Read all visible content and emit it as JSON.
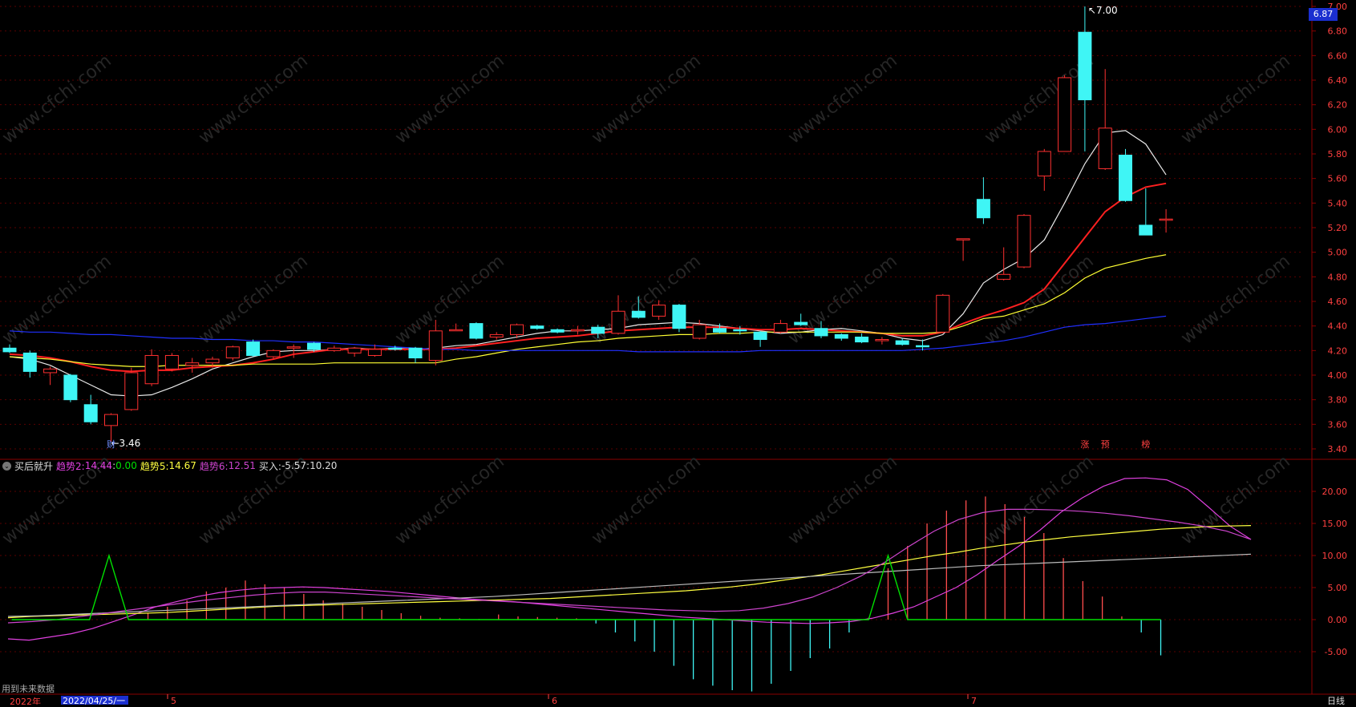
{
  "chart_data": [
    {
      "type": "candlestick",
      "title": "",
      "price_axis": {
        "ticks": [
          "7.00",
          "6.80",
          "6.60",
          "6.40",
          "6.20",
          "6.00",
          "5.80",
          "5.60",
          "5.40",
          "5.20",
          "5.00",
          "4.80",
          "4.60",
          "4.40",
          "4.20",
          "4.00",
          "3.80",
          "3.60",
          "3.40"
        ],
        "ylim": [
          3.34,
          7.02
        ]
      },
      "current_price": "6.87",
      "high_label": "7.00",
      "low_label": "3.46",
      "markers": [
        {
          "text": "财",
          "bar": 5,
          "color": "#6f8cff"
        },
        {
          "text": "涨",
          "bar": 53,
          "color": "#ff4040"
        },
        {
          "text": "预",
          "bar": 54,
          "color": "#ff4040"
        },
        {
          "text": "榜",
          "bar": 56,
          "color": "#ff4040"
        }
      ],
      "candles": [
        [
          4.22,
          4.25,
          4.18,
          4.19
        ],
        [
          4.18,
          4.2,
          3.98,
          4.03
        ],
        [
          4.02,
          4.07,
          3.92,
          4.05
        ],
        [
          4.0,
          4.01,
          3.78,
          3.8
        ],
        [
          3.76,
          3.84,
          3.6,
          3.62
        ],
        [
          3.59,
          3.69,
          3.46,
          3.68
        ],
        [
          3.72,
          4.06,
          3.71,
          4.02
        ],
        [
          3.93,
          4.21,
          3.91,
          4.16
        ],
        [
          4.05,
          4.18,
          4.03,
          4.16
        ],
        [
          4.08,
          4.14,
          4.02,
          4.1
        ],
        [
          4.1,
          4.15,
          4.06,
          4.13
        ],
        [
          4.14,
          4.24,
          4.12,
          4.23
        ],
        [
          4.27,
          4.29,
          4.15,
          4.16
        ],
        [
          4.15,
          4.21,
          4.13,
          4.2
        ],
        [
          4.22,
          4.25,
          4.14,
          4.23
        ],
        [
          4.26,
          4.27,
          4.19,
          4.21
        ],
        [
          4.2,
          4.24,
          4.19,
          4.22
        ],
        [
          4.18,
          4.23,
          4.15,
          4.22
        ],
        [
          4.16,
          4.25,
          4.15,
          4.21
        ],
        [
          4.22,
          4.24,
          4.2,
          4.21
        ],
        [
          4.22,
          4.23,
          4.1,
          4.14
        ],
        [
          4.12,
          4.45,
          4.08,
          4.36
        ],
        [
          4.37,
          4.42,
          4.36,
          4.37
        ],
        [
          4.42,
          4.43,
          4.29,
          4.3
        ],
        [
          4.31,
          4.35,
          4.29,
          4.33
        ],
        [
          4.33,
          4.42,
          4.3,
          4.41
        ],
        [
          4.4,
          4.41,
          4.37,
          4.38
        ],
        [
          4.37,
          4.38,
          4.34,
          4.35
        ],
        [
          4.36,
          4.4,
          4.33,
          4.37
        ],
        [
          4.39,
          4.41,
          4.3,
          4.34
        ],
        [
          4.34,
          4.65,
          4.33,
          4.52
        ],
        [
          4.52,
          4.64,
          4.46,
          4.47
        ],
        [
          4.48,
          4.61,
          4.45,
          4.57
        ],
        [
          4.57,
          4.58,
          4.35,
          4.38
        ],
        [
          4.3,
          4.45,
          4.29,
          4.41
        ],
        [
          4.38,
          4.42,
          4.34,
          4.35
        ],
        [
          4.37,
          4.4,
          4.33,
          4.36
        ],
        [
          4.35,
          4.36,
          4.23,
          4.29
        ],
        [
          4.35,
          4.45,
          4.34,
          4.42
        ],
        [
          4.43,
          4.5,
          4.4,
          4.41
        ],
        [
          4.38,
          4.44,
          4.3,
          4.32
        ],
        [
          4.33,
          4.34,
          4.28,
          4.3
        ],
        [
          4.31,
          4.34,
          4.26,
          4.27
        ],
        [
          4.28,
          4.31,
          4.25,
          4.29
        ],
        [
          4.28,
          4.3,
          4.24,
          4.25
        ],
        [
          4.24,
          4.29,
          4.2,
          4.23
        ],
        [
          4.35,
          4.66,
          4.34,
          4.65
        ],
        [
          5.1,
          5.11,
          4.93,
          5.11
        ],
        [
          5.43,
          5.61,
          5.23,
          5.28
        ],
        [
          4.78,
          5.04,
          4.77,
          4.82
        ],
        [
          4.88,
          5.31,
          4.87,
          5.3
        ],
        [
          5.62,
          5.84,
          5.5,
          5.82
        ],
        [
          5.82,
          6.44,
          5.82,
          6.42
        ],
        [
          6.79,
          7.0,
          5.82,
          6.24
        ],
        [
          5.68,
          6.49,
          5.67,
          6.01
        ],
        [
          5.79,
          5.84,
          5.41,
          5.42
        ],
        [
          5.22,
          5.52,
          5.15,
          5.14
        ],
        [
          5.27,
          5.35,
          5.16,
          5.27
        ]
      ],
      "ma_series": [
        {
          "color": "#e8e8e8",
          "values": [
            4.15,
            4.13,
            4.08,
            4.0,
            3.92,
            3.84,
            3.83,
            3.84,
            3.9,
            3.97,
            4.05,
            4.1,
            4.15,
            4.19,
            4.2,
            4.2,
            4.21,
            4.22,
            4.21,
            4.22,
            4.21,
            4.22,
            4.24,
            4.25,
            4.28,
            4.31,
            4.34,
            4.36,
            4.36,
            4.37,
            4.38,
            4.41,
            4.42,
            4.43,
            4.42,
            4.4,
            4.38,
            4.36,
            4.34,
            4.35,
            4.37,
            4.38,
            4.36,
            4.34,
            4.3,
            4.28,
            4.33,
            4.5,
            4.75,
            4.86,
            4.95,
            5.1,
            5.4,
            5.72,
            5.97,
            5.99,
            5.88,
            5.63
          ]
        },
        {
          "color": "#ff2020",
          "values": [
            4.17,
            4.16,
            4.14,
            4.11,
            4.07,
            4.04,
            4.03,
            4.04,
            4.04,
            4.06,
            4.07,
            4.08,
            4.1,
            4.13,
            4.17,
            4.19,
            4.21,
            4.21,
            4.21,
            4.21,
            4.21,
            4.21,
            4.22,
            4.24,
            4.26,
            4.28,
            4.3,
            4.31,
            4.32,
            4.34,
            4.36,
            4.37,
            4.38,
            4.39,
            4.39,
            4.39,
            4.38,
            4.37,
            4.37,
            4.38,
            4.37,
            4.36,
            4.35,
            4.34,
            4.32,
            4.32,
            4.35,
            4.42,
            4.48,
            4.53,
            4.59,
            4.7,
            4.91,
            5.12,
            5.33,
            5.45,
            5.53,
            5.56
          ]
        },
        {
          "color": "#ffff33",
          "values": [
            4.15,
            4.14,
            4.13,
            4.11,
            4.09,
            4.08,
            4.07,
            4.07,
            4.08,
            4.08,
            4.08,
            4.08,
            4.09,
            4.09,
            4.09,
            4.09,
            4.1,
            4.1,
            4.1,
            4.1,
            4.1,
            4.1,
            4.13,
            4.15,
            4.18,
            4.21,
            4.23,
            4.25,
            4.27,
            4.28,
            4.3,
            4.31,
            4.32,
            4.33,
            4.33,
            4.34,
            4.34,
            4.35,
            4.35,
            4.35,
            4.35,
            4.35,
            4.35,
            4.34,
            4.34,
            4.34,
            4.35,
            4.4,
            4.46,
            4.48,
            4.53,
            4.58,
            4.67,
            4.79,
            4.87,
            4.91,
            4.95,
            4.98
          ]
        },
        {
          "color": "#2030ff",
          "values": [
            4.36,
            4.35,
            4.35,
            4.34,
            4.33,
            4.33,
            4.32,
            4.31,
            4.3,
            4.3,
            4.29,
            4.29,
            4.28,
            4.28,
            4.27,
            4.27,
            4.26,
            4.25,
            4.24,
            4.23,
            4.22,
            4.21,
            4.21,
            4.2,
            4.2,
            4.2,
            4.2,
            4.2,
            4.2,
            4.2,
            4.2,
            4.19,
            4.19,
            4.19,
            4.19,
            4.19,
            4.19,
            4.2,
            4.2,
            4.2,
            4.2,
            4.2,
            4.2,
            4.2,
            4.2,
            4.21,
            4.22,
            4.24,
            4.26,
            4.28,
            4.31,
            4.35,
            4.39,
            4.41,
            4.42,
            4.44,
            4.46,
            4.48
          ]
        }
      ]
    },
    {
      "type": "line",
      "title": "买后就升",
      "yaxis_ticks": [
        "20.00",
        "15.00",
        "10.00",
        "5.00",
        "0.00",
        "-5.00"
      ],
      "ylim": [
        -11.2,
        25.5
      ],
      "series": [
        {
          "name": "趋势2",
          "color": "#e040e0",
          "values": [
            -3.0,
            -3.2,
            -2.7,
            -2.2,
            -1.4,
            -0.3,
            0.8,
            2.0,
            2.8,
            3.6,
            4.2,
            4.6,
            4.9,
            5.0,
            5.1,
            5.0,
            4.8,
            4.6,
            4.4,
            4.1,
            3.8,
            3.5,
            3.2,
            3.0,
            2.8,
            2.5,
            2.2,
            1.9,
            1.6,
            1.3,
            1.0,
            0.7,
            0.4,
            0.2,
            0.0,
            -0.2,
            -0.4,
            -0.5,
            -0.6,
            -0.5,
            -0.3,
            0.2,
            1.0,
            2.0,
            3.5,
            5.0,
            7.0,
            9.3,
            11.5,
            14.0,
            16.8,
            19.0,
            20.8,
            22.0,
            22.1,
            21.8,
            20.3,
            17.5,
            14.6,
            12.5
          ]
        },
        {
          "name": "",
          "color": "#00e000",
          "values": [
            0,
            0,
            0,
            0,
            0,
            10,
            0,
            0,
            0,
            0,
            0,
            0,
            0,
            0,
            0,
            0,
            0,
            0,
            0,
            0,
            0,
            0,
            0,
            0,
            0,
            0,
            0,
            0,
            0,
            0,
            0,
            0,
            0,
            0,
            0,
            0,
            0,
            0,
            0,
            0,
            0,
            0,
            0,
            0,
            0,
            10,
            0,
            0,
            0,
            0,
            0,
            0,
            0,
            0,
            0,
            0,
            0,
            0,
            0,
            0
          ]
        },
        {
          "name": "趋势5",
          "color": "#ffff40",
          "values": [
            0.3,
            0.5,
            0.6,
            0.7,
            0.8,
            0.9,
            1.0,
            1.1,
            1.3,
            1.5,
            1.7,
            1.9,
            2.1,
            2.2,
            2.3,
            2.4,
            2.5,
            2.6,
            2.7,
            2.8,
            2.9,
            3.0,
            3.1,
            3.2,
            3.3,
            3.5,
            3.7,
            3.9,
            4.1,
            4.3,
            4.5,
            4.8,
            5.1,
            5.5,
            6.0,
            6.5,
            7.0,
            7.6,
            8.2,
            8.8,
            9.4,
            10.0,
            10.5,
            11.1,
            11.6,
            12.1,
            12.5,
            12.9,
            13.2,
            13.5,
            13.8,
            14.1,
            14.3,
            14.5,
            14.6,
            14.67
          ]
        },
        {
          "name": "",
          "color": "#bbbbbb",
          "values": [
            0.5,
            0.6,
            0.8,
            1.0,
            1.2,
            1.4,
            1.6,
            1.8,
            2.0,
            2.2,
            2.4,
            2.6,
            2.8,
            3.0,
            3.2,
            3.4,
            3.6,
            3.9,
            4.2,
            4.5,
            4.8,
            5.1,
            5.4,
            5.7,
            6.0,
            6.3,
            6.6,
            6.9,
            7.2,
            7.5,
            7.8,
            8.1,
            8.4,
            8.6,
            8.8,
            9.0,
            9.2,
            9.4,
            9.6,
            9.8,
            10.0,
            10.2
          ]
        },
        {
          "name": "趋势6",
          "color": "#cc44cc",
          "values": [
            -0.5,
            -0.3,
            0.0,
            0.5,
            1.0,
            1.5,
            2.0,
            2.5,
            3.0,
            3.4,
            3.8,
            4.1,
            4.3,
            4.3,
            4.1,
            3.9,
            3.7,
            3.5,
            3.3,
            3.1,
            2.9,
            2.7,
            2.5,
            2.3,
            2.1,
            1.9,
            1.7,
            1.5,
            1.4,
            1.3,
            1.4,
            1.8,
            2.5,
            3.5,
            5.0,
            6.8,
            9.0,
            11.5,
            13.8,
            15.6,
            16.7,
            17.2,
            17.2,
            17.1,
            16.9,
            16.6,
            16.2,
            15.7,
            15.2,
            14.6,
            13.8,
            12.51
          ]
        },
        {
          "name": "买入",
          "color": "#ff4d4d",
          "values": [
            0,
            0,
            0,
            0,
            0,
            0,
            0,
            1.0,
            2.0,
            3.0,
            4.4,
            5.0,
            6.1,
            5.5,
            5.0,
            4.0,
            3.0,
            2.5,
            2.0,
            1.5,
            1.0,
            0.6,
            0.3,
            0.2,
            0.1,
            0.8,
            0.5,
            0.4,
            0.3,
            0.2,
            -0.6,
            -2.0,
            -3.4,
            -5.0,
            -7.2,
            -9.3,
            -10.3,
            -11.0,
            -11.2,
            -10.0,
            -8.0,
            -6.0,
            -4.5,
            -2.0,
            0.3,
            8.0,
            11.5,
            15.0,
            17.0,
            18.6,
            19.2,
            18.0,
            16.0,
            13.5,
            9.6,
            6.0,
            3.6,
            0.5,
            -2.0,
            -5.57
          ]
        }
      ],
      "values_text": {
        "trend2": "14.44",
        "green": "0.00",
        "trend5": "14.67",
        "trend6": "12.51",
        "buy": "-5.57",
        "buy2": "10.20"
      }
    }
  ],
  "indicator": {
    "name": "买后就升",
    "trend2_label": "趋势2:",
    "trend2_val": "14.44",
    "sep": ":",
    "green_val": "0.00",
    "trend5_label": "趋势5:",
    "trend5_val": "14.67",
    "trend6_label": "趋势6:",
    "trend6_val": "12.51",
    "buy_label": "买入:",
    "buy_val": "-5.57",
    "buy_sep": ":",
    "buy_val2": "10.20"
  },
  "bottom": {
    "year": "2022年",
    "cursor_date": "2022/04/25/一",
    "months": [
      "5",
      "6",
      "7"
    ],
    "future_note": "用到未来数据",
    "period": "日线"
  },
  "watermark": "www.cfchi.com"
}
